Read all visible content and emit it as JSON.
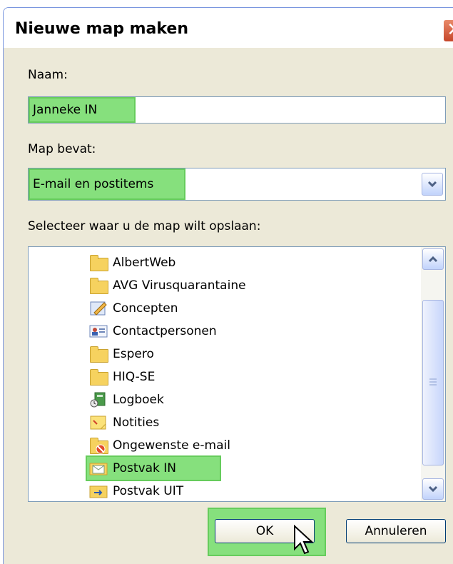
{
  "dialog": {
    "title": "Nieuwe map maken",
    "close_glyph": "✕"
  },
  "name_field": {
    "label": "Naam:",
    "value": "Janneke IN"
  },
  "contains": {
    "label": "Map bevat:",
    "selected": "E-mail en postitems"
  },
  "location": {
    "label": "Selecteer waar u de map wilt opslaan:",
    "items": [
      {
        "label": "AlbertWeb",
        "icon": "folder-icon"
      },
      {
        "label": "AVG Virusquarantaine",
        "icon": "folder-icon"
      },
      {
        "label": "Concepten",
        "icon": "drafts-icon"
      },
      {
        "label": "Contactpersonen",
        "icon": "contacts-icon"
      },
      {
        "label": "Espero",
        "icon": "folder-icon"
      },
      {
        "label": "HIQ-SE",
        "icon": "folder-icon"
      },
      {
        "label": "Logboek",
        "icon": "journal-icon"
      },
      {
        "label": "Notities",
        "icon": "notes-icon"
      },
      {
        "label": "Ongewenste e-mail",
        "icon": "junk-mail-icon"
      },
      {
        "label": "Postvak IN",
        "icon": "inbox-icon",
        "selected": true
      },
      {
        "label": "Postvak UIT",
        "icon": "outbox-icon"
      }
    ]
  },
  "buttons": {
    "ok": "OK",
    "cancel": "Annuleren"
  },
  "colors": {
    "highlight": "#86e07d",
    "dialog_bg": "#ece9d8"
  }
}
